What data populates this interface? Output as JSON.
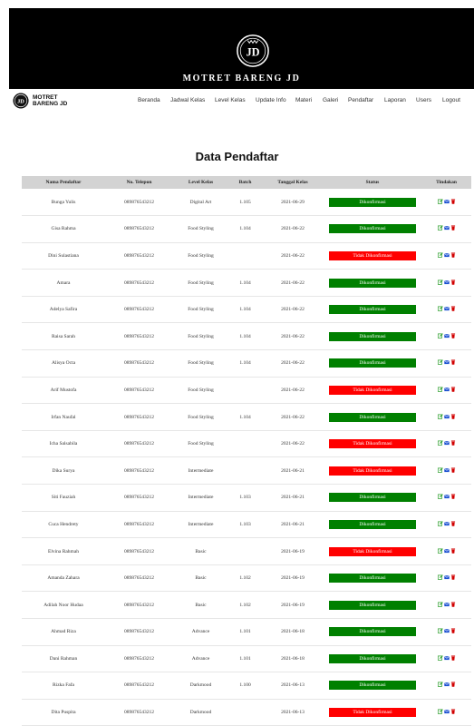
{
  "brand": {
    "hero_title": "MOTRET BARENG JD",
    "logo_text": "JD",
    "nav_brand_line1": "MOTRET",
    "nav_brand_line2": "BARENG JD"
  },
  "nav": [
    "Beranda",
    "Jadwal Kelas",
    "Level Kelas",
    "Update Info",
    "Materi",
    "Galeri",
    "Pendaftar",
    "Laporan",
    "Users",
    "Logout"
  ],
  "page_title": "Data Pendaftar",
  "table": {
    "headers": [
      "Nama Pendaftar",
      "No. Telepon",
      "Level Kelas",
      "Batch",
      "Tanggal Kelas",
      "Status",
      "Tindakan"
    ],
    "rows": [
      {
        "nama": "Bunga Yulis",
        "telp": "089876543212",
        "level": "Digital Art",
        "batch": "1.105",
        "tanggal": "2021-06-29",
        "status": "Dikonfirmasi"
      },
      {
        "nama": "Gisa Rahma",
        "telp": "089876543212",
        "level": "Food Styling",
        "batch": "1.104",
        "tanggal": "2021-06-22",
        "status": "Dikonfirmasi"
      },
      {
        "nama": "Dini Sulastiana",
        "telp": "089876543212",
        "level": "Food Styling",
        "batch": "",
        "tanggal": "2021-06-22",
        "status": "Tidak Dikonfirmasi"
      },
      {
        "nama": "Amara",
        "telp": "089876543212",
        "level": "Food Styling",
        "batch": "1.104",
        "tanggal": "2021-06-22",
        "status": "Dikonfirmasi"
      },
      {
        "nama": "Adelya Safira",
        "telp": "089876543212",
        "level": "Food Styling",
        "batch": "1.104",
        "tanggal": "2021-06-22",
        "status": "Dikonfirmasi"
      },
      {
        "nama": "Raisa Sarah",
        "telp": "089876543212",
        "level": "Food Styling",
        "batch": "1.104",
        "tanggal": "2021-06-22",
        "status": "Dikonfirmasi"
      },
      {
        "nama": "Alisya Octa",
        "telp": "089876543212",
        "level": "Food Styling",
        "batch": "1.104",
        "tanggal": "2021-06-22",
        "status": "Dikonfirmasi"
      },
      {
        "nama": "Arif Mustofa",
        "telp": "089876543212",
        "level": "Food Styling",
        "batch": "",
        "tanggal": "2021-06-22",
        "status": "Tidak Dikonfirmasi"
      },
      {
        "nama": "Irfan Naufal",
        "telp": "089876543212",
        "level": "Food Styling",
        "batch": "1.104",
        "tanggal": "2021-06-22",
        "status": "Dikonfirmasi"
      },
      {
        "nama": "Icha Salsabila",
        "telp": "089876543212",
        "level": "Food Styling",
        "batch": "",
        "tanggal": "2021-06-22",
        "status": "Tidak Dikonfirmasi"
      },
      {
        "nama": "Dika Surya",
        "telp": "089876543212",
        "level": "Intermediate",
        "batch": "",
        "tanggal": "2021-06-21",
        "status": "Tidak Dikonfirmasi"
      },
      {
        "nama": "Siti Fauziah",
        "telp": "089876543212",
        "level": "Intermediate",
        "batch": "1.103",
        "tanggal": "2021-06-21",
        "status": "Dikonfirmasi"
      },
      {
        "nama": "Cuca Hendrety",
        "telp": "089876543212",
        "level": "Intermediate",
        "batch": "1.103",
        "tanggal": "2021-06-21",
        "status": "Dikonfirmasi"
      },
      {
        "nama": "Elvina Rahmah",
        "telp": "089876543212",
        "level": "Basic",
        "batch": "",
        "tanggal": "2021-06-19",
        "status": "Tidak Dikonfirmasi"
      },
      {
        "nama": "Amanda Zahara",
        "telp": "089876543212",
        "level": "Basic",
        "batch": "1.102",
        "tanggal": "2021-06-19",
        "status": "Dikonfirmasi"
      },
      {
        "nama": "Adilah Noor Hudaa",
        "telp": "089876543212",
        "level": "Basic",
        "batch": "1.102",
        "tanggal": "2021-06-19",
        "status": "Dikonfirmasi"
      },
      {
        "nama": "Ahmad Riza",
        "telp": "089876543212",
        "level": "Advance",
        "batch": "1.101",
        "tanggal": "2021-06-18",
        "status": "Dikonfirmasi"
      },
      {
        "nama": "Dani Rahman",
        "telp": "089876543212",
        "level": "Advance",
        "batch": "1.101",
        "tanggal": "2021-06-18",
        "status": "Dikonfirmasi"
      },
      {
        "nama": "Rizka Fafa",
        "telp": "089876543212",
        "level": "Darkmood",
        "batch": "1.100",
        "tanggal": "2021-06-13",
        "status": "Dikonfirmasi"
      },
      {
        "nama": "Dita Puspita",
        "telp": "089876543212",
        "level": "Darkmood",
        "batch": "",
        "tanggal": "2021-06-13",
        "status": "Tidak Dikonfirmasi"
      }
    ],
    "action_icons": [
      "edit-icon",
      "mail-icon",
      "trash-icon"
    ]
  },
  "colors": {
    "confirmed": "#008000",
    "unconfirmed": "#ff0000",
    "header_bg": "#000000",
    "table_head": "#d3d3d3"
  }
}
